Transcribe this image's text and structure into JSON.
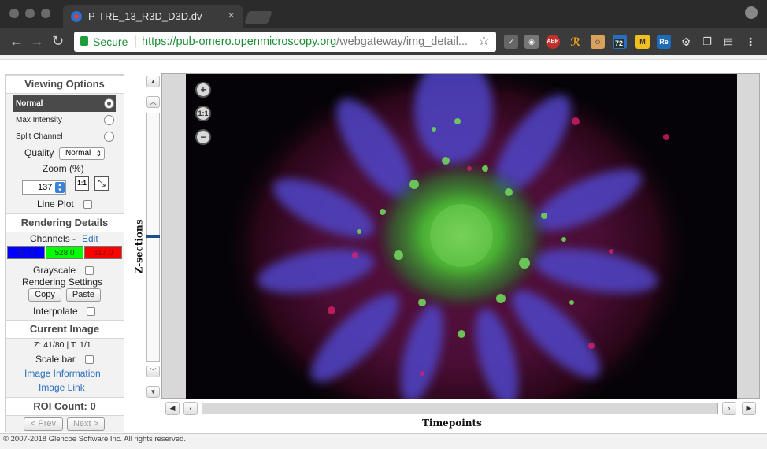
{
  "browser": {
    "tab_title": "P-TRE_13_R3D_D3D.dv",
    "secure_label": "Secure",
    "url_scheme": "https://",
    "url_host": "pub-omero.openmicroscopy.org",
    "url_path": "/webgateway/img_detail...",
    "extension_badge": "72",
    "ext_abp": "ABP",
    "ext_m": "M",
    "ext_re": "Re"
  },
  "viewing_options": {
    "title": "Viewing Options",
    "modes": [
      "Normal",
      "Max Intensity",
      "Split Channel"
    ],
    "selected_mode": "Normal",
    "quality_label": "Quality",
    "quality_value": "Normal",
    "zoom_label": "Zoom (%)",
    "zoom_value": "137",
    "zoom_1to1": "1:1",
    "line_plot_label": "Line Plot"
  },
  "rendering_details": {
    "title": "Rendering Details",
    "channels_label": "Channels -",
    "edit_link": "Edit",
    "channels": [
      {
        "label": "457.0",
        "color": "#0000ff",
        "text_color": "#1a1a88"
      },
      {
        "label": "528.0",
        "color": "#00ff00",
        "text_color": "#1a4a1a"
      },
      {
        "label": "617.0",
        "color": "#ff0000",
        "text_color": "#7a1010"
      }
    ],
    "grayscale_label": "Grayscale",
    "rendering_settings_label": "Rendering Settings",
    "copy_label": "Copy",
    "paste_label": "Paste",
    "interpolate_label": "Interpolate"
  },
  "current_image": {
    "title": "Current Image",
    "position": "Z: 41/80 | T: 1/1",
    "scale_bar_label": "Scale bar",
    "image_information_link": "Image Information",
    "image_link": "Image Link",
    "roi_count": "ROI Count: 0",
    "prev_label": "< Prev",
    "next_label": "Next >"
  },
  "viewer": {
    "z_label": "Z-sections",
    "t_label": "Timepoints",
    "zoom_in": "+",
    "zoom_reset": "1:1",
    "zoom_out": "−"
  },
  "footer": {
    "copyright": "© 2007-2018 Glencoe Software Inc. All rights reserved."
  }
}
